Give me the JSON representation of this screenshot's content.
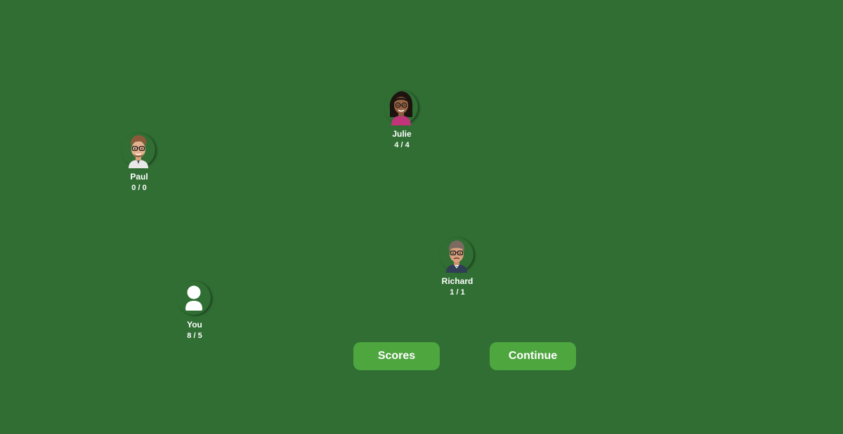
{
  "players": {
    "julie": {
      "name": "Julie",
      "score": "4 / 4",
      "avatar_icon": "woman-avatar-icon"
    },
    "paul": {
      "name": "Paul",
      "score": "0 / 0",
      "avatar_icon": "man-glasses-avatar-icon"
    },
    "richard": {
      "name": "Richard",
      "score": "1 / 1",
      "avatar_icon": "older-man-avatar-icon"
    },
    "you": {
      "name": "You",
      "score": "8 / 5",
      "avatar_icon": "user-silhouette-icon"
    }
  },
  "buttons": {
    "scores_label": "Scores",
    "continue_label": "Continue"
  },
  "colors": {
    "table": "#306e33",
    "button": "#4ea63f",
    "text": "#ffffff"
  }
}
